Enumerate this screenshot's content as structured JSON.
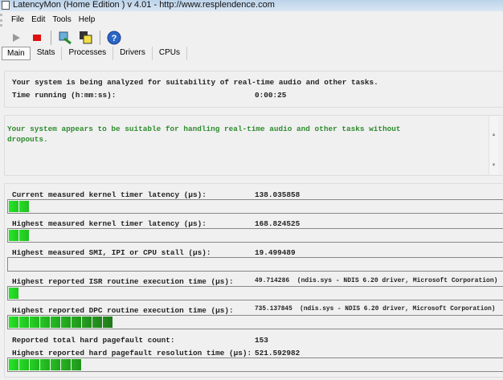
{
  "window": {
    "title": "LatencyMon  (Home Edition )  v 4.01 - http://www.resplendence.com"
  },
  "menu": [
    "File",
    "Edit",
    "Tools",
    "Help"
  ],
  "toolbar": {
    "icons": [
      "play-icon",
      "stop-icon",
      "report-icon",
      "windows-icon",
      "help-icon"
    ]
  },
  "tabs": [
    "Main",
    "Stats",
    "Processes",
    "Drivers",
    "CPUs"
  ],
  "status": {
    "analyzing": "Your system is being analyzed for suitability of real-time audio and other tasks.",
    "time_label": "Time running (h:mm:ss):",
    "time_value": "0:00:25",
    "verdict": "Your system appears to be suitable for handling real-time audio and other tasks without\ndropouts."
  },
  "colors": {
    "verdict": "#2e8b2e",
    "bar_light": "#22dd22",
    "bar_dark": "#207a20"
  },
  "metrics": [
    {
      "label": "Current measured kernel timer latency (µs):",
      "value": "138.035858",
      "blocks": 2
    },
    {
      "label": "Highest measured kernel timer latency (µs):",
      "value": "168.824525",
      "blocks": 2
    },
    {
      "label": "Highest measured SMI, IPI or CPU stall (µs):",
      "value": "19.499489",
      "blocks": 0
    },
    {
      "label": "Highest reported ISR routine execution time (µs):",
      "value": "49.714286  (ndis.sys - NDIS 6.20 driver, Microsoft Corporation)",
      "blocks": 1
    },
    {
      "label": "Highest reported DPC routine execution time (µs):",
      "value": "735.137845  (ndis.sys - NDIS 6.20 driver, Microsoft Corporation)",
      "blocks": 10
    },
    {
      "label": "Reported total hard pagefault count:",
      "value": "153"
    },
    {
      "label": "Highest reported hard pagefault resolution time (µs):",
      "value": "521.592982",
      "blocks": 7
    }
  ]
}
